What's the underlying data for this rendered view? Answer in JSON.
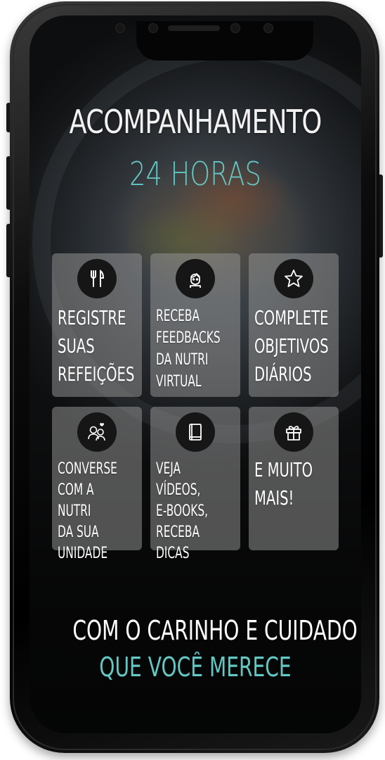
{
  "headline": {
    "line1": "ACOMPANHAMENTO",
    "line2": "24 HORAS"
  },
  "features": [
    {
      "icon": "fork-knife-icon",
      "label": "REGISTRE\nSUAS\nREFEIÇÕES"
    },
    {
      "icon": "nutritionist-icon",
      "label": "RECEBA\nFEEDBACKS\nDA NUTRI\nVIRTUAL"
    },
    {
      "icon": "star-icon",
      "label": "COMPLETE\nOBJETIVOS\nDIÁRIOS"
    },
    {
      "icon": "chat-people-icon",
      "label": "CONVERSE\nCOM A NUTRI\nDA SUA\nUNIDADE"
    },
    {
      "icon": "ebook-icon",
      "label": "VEJA VÍDEOS,\nE-BOOKS,\nRECEBA DICAS"
    },
    {
      "icon": "gift-icon",
      "label": "E MUITO\nMAIS!"
    }
  ],
  "footer": {
    "line1": "COM O CARINHO E CUIDADO",
    "line2": "QUE VOCÊ MERECE"
  },
  "colors": {
    "accent": "#63c7c4",
    "text": "#ffffff",
    "tile": "#969696"
  }
}
